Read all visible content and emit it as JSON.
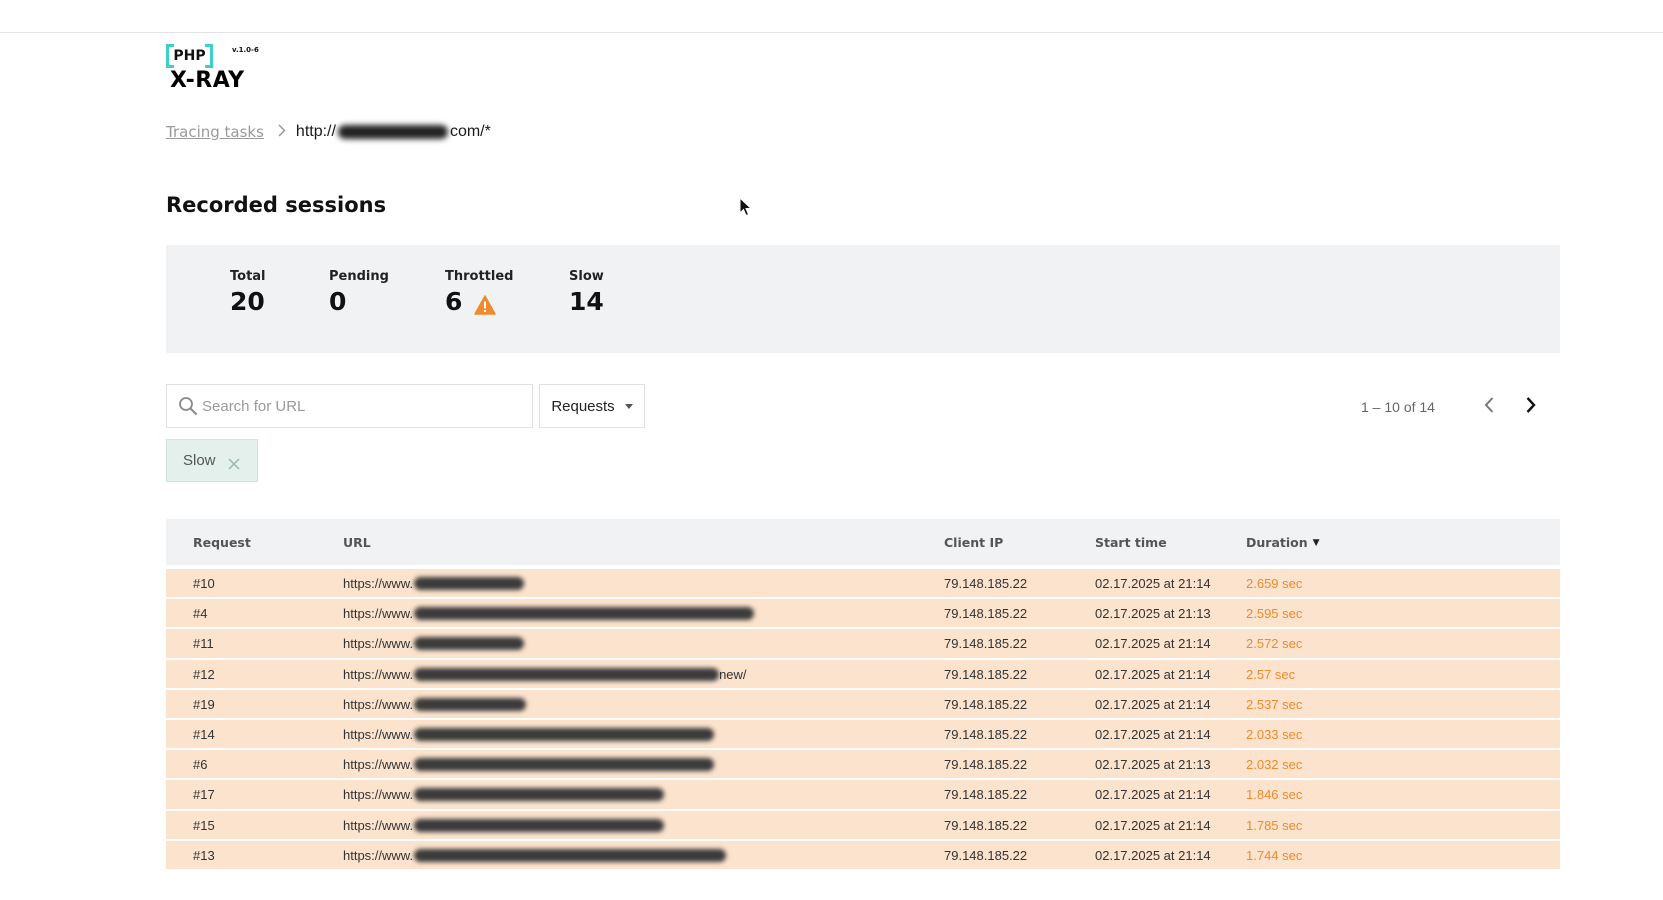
{
  "logo": {
    "php": "PHP",
    "product": "X-RAY",
    "version": "v.1.0-6"
  },
  "breadcrumb": {
    "parent": "Tracing tasks",
    "current_prefix": "http://",
    "current_suffix": "com/*"
  },
  "page_title": "Recorded sessions",
  "stats": {
    "total": {
      "label": "Total",
      "value": "20"
    },
    "pending": {
      "label": "Pending",
      "value": "0"
    },
    "throttled": {
      "label": "Throttled",
      "value": "6"
    },
    "slow": {
      "label": "Slow",
      "value": "14"
    }
  },
  "search": {
    "placeholder": "Search for URL",
    "value": ""
  },
  "filter_dropdown": {
    "selected": "Requests"
  },
  "pager": {
    "text": "1 – 10 of 14"
  },
  "active_filter": {
    "label": "Slow"
  },
  "table": {
    "columns": {
      "request": "Request",
      "url": "URL",
      "client_ip": "Client IP",
      "start_time": "Start time",
      "duration": "Duration"
    },
    "rows": [
      {
        "request": "#10",
        "url_prefix": "https://www.",
        "ip": "79.148.185.22",
        "start": "02.17.2025 at 21:14",
        "duration": "2.659 sec"
      },
      {
        "request": "#4",
        "url_prefix": "https://www.",
        "ip": "79.148.185.22",
        "start": "02.17.2025 at 21:13",
        "duration": "2.595 sec"
      },
      {
        "request": "#11",
        "url_prefix": "https://www.",
        "ip": "79.148.185.22",
        "start": "02.17.2025 at 21:14",
        "duration": "2.572 sec"
      },
      {
        "request": "#12",
        "url_prefix": "https://www.",
        "url_suffix": "new/",
        "ip": "79.148.185.22",
        "start": "02.17.2025 at 21:14",
        "duration": "2.57 sec"
      },
      {
        "request": "#19",
        "url_prefix": "https://www.",
        "ip": "79.148.185.22",
        "start": "02.17.2025 at 21:14",
        "duration": "2.537 sec"
      },
      {
        "request": "#14",
        "url_prefix": "https://www.",
        "ip": "79.148.185.22",
        "start": "02.17.2025 at 21:14",
        "duration": "2.033 sec"
      },
      {
        "request": "#6",
        "url_prefix": "https://www.",
        "ip": "79.148.185.22",
        "start": "02.17.2025 at 21:13",
        "duration": "2.032 sec"
      },
      {
        "request": "#17",
        "url_prefix": "https://www.",
        "ip": "79.148.185.22",
        "start": "02.17.2025 at 21:14",
        "duration": "1.846 sec"
      },
      {
        "request": "#15",
        "url_prefix": "https://www.",
        "ip": "79.148.185.22",
        "start": "02.17.2025 at 21:14",
        "duration": "1.785 sec"
      },
      {
        "request": "#13",
        "url_prefix": "https://www.",
        "ip": "79.148.185.22",
        "start": "02.17.2025 at 21:14",
        "duration": "1.744 sec"
      }
    ]
  },
  "colors": {
    "accent_teal": "#3ed0c4",
    "slow_row": "#fbe3cd",
    "duration_orange": "#f08a2c",
    "warning": "#f08a2c"
  },
  "icons": {
    "throttled_warning": "warning-icon",
    "search": "search-icon",
    "close": "close-icon",
    "prev": "chevron-left-icon",
    "next": "chevron-right-icon"
  }
}
